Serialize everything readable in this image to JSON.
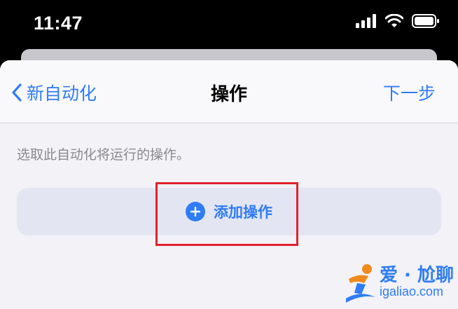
{
  "status_bar": {
    "time": "11:47",
    "icons": [
      "cellular-signal-icon",
      "wifi-icon",
      "battery-icon"
    ]
  },
  "nav": {
    "back_label": "新自动化",
    "title": "操作",
    "next_label": "下一步"
  },
  "content": {
    "hint": "选取此自动化将运行的操作。",
    "add_action_label": "添加操作"
  },
  "watermark": {
    "title": "爱 · 尬聊",
    "url": "igaliao.com"
  },
  "colors": {
    "accent": "#2f7cf6",
    "highlight": "#e1212d",
    "sheet_background": "#f2f2f7",
    "add_button_background": "#e3e6f2"
  }
}
